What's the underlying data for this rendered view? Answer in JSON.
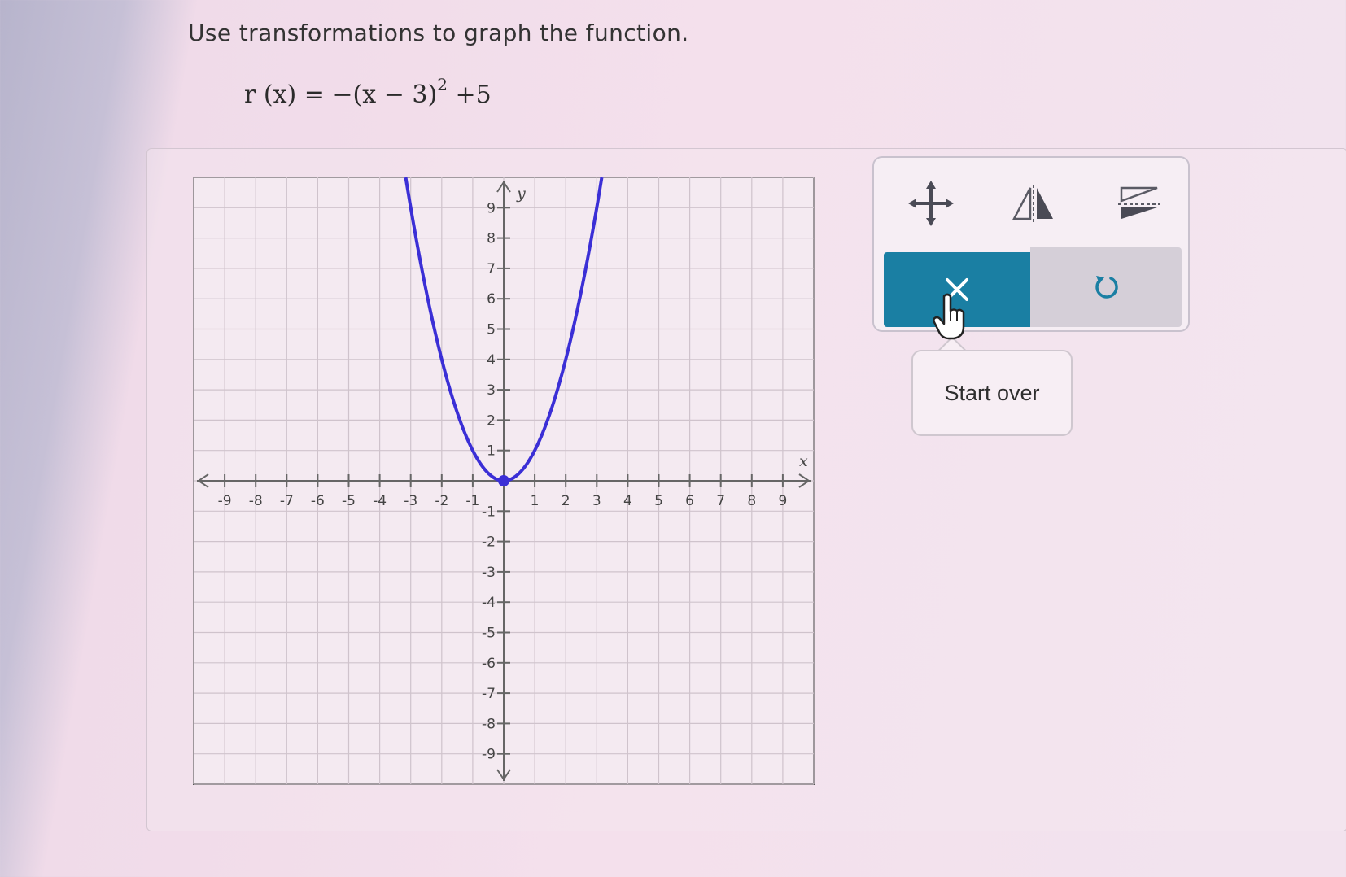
{
  "prompt": "Use transformations to graph the function.",
  "function": {
    "lhs": "r (x) = −(x − 3)",
    "exponent": "2",
    "rhs": " +5"
  },
  "chart_data": {
    "type": "line",
    "xlim": [
      -10,
      10
    ],
    "ylim": [
      -10,
      10
    ],
    "grid": true,
    "xlabel": "x",
    "ylabel": "y",
    "x_ticks": [
      -9,
      -8,
      -7,
      -6,
      -5,
      -4,
      -3,
      -2,
      -1,
      1,
      2,
      3,
      4,
      5,
      6,
      7,
      8,
      9
    ],
    "y_ticks": [
      -9,
      -8,
      -7,
      -6,
      -5,
      -4,
      -3,
      -2,
      -1,
      1,
      2,
      3,
      4,
      5,
      6,
      7,
      8,
      9
    ],
    "series": [
      {
        "function": "y = x^2",
        "color": "#3b2fd6",
        "vertex": [
          0,
          0
        ]
      }
    ]
  },
  "toolbar": {
    "tools": [
      {
        "icon": "move-arrows-icon"
      },
      {
        "icon": "reflect-vertical-axis-icon"
      },
      {
        "icon": "reflect-horizontal-axis-icon"
      }
    ],
    "clear_icon": "x-icon",
    "undo_icon": "undo-icon",
    "accent": "#1a7fa3"
  },
  "tooltip": {
    "label": "Start over"
  }
}
